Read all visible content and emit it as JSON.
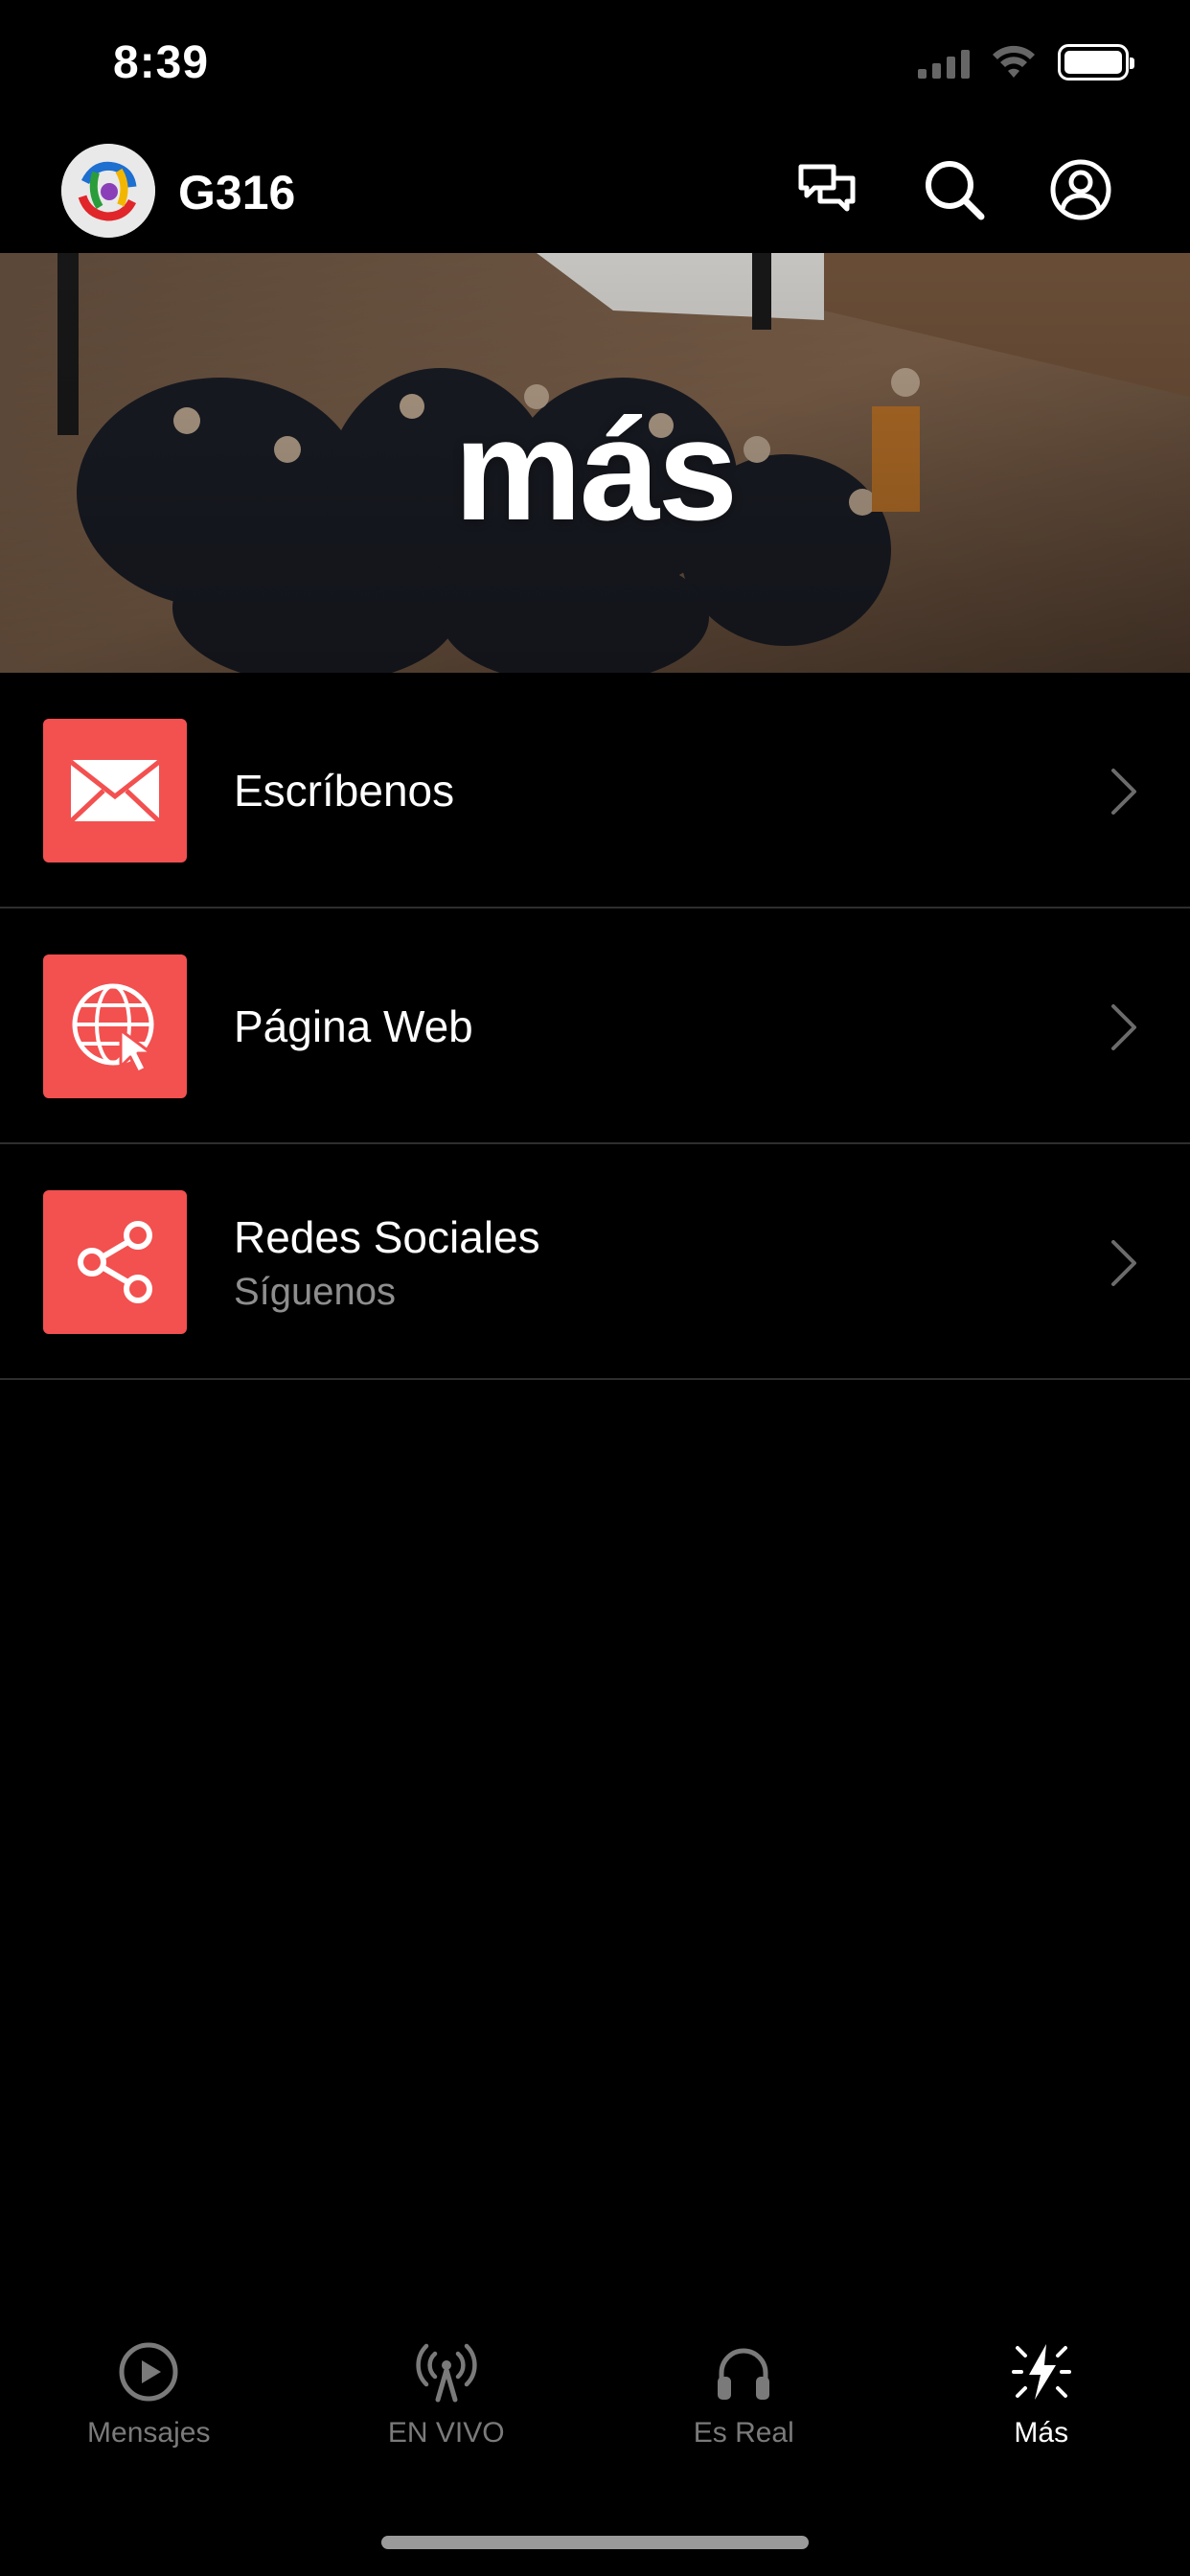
{
  "status_bar": {
    "time": "8:39"
  },
  "header": {
    "title": "G316"
  },
  "hero": {
    "title": "más"
  },
  "menu": [
    {
      "title": "Escríbenos",
      "subtitle": "",
      "icon": "mail-icon"
    },
    {
      "title": "Página Web",
      "subtitle": "",
      "icon": "globe-cursor-icon"
    },
    {
      "title": "Redes Sociales",
      "subtitle": "Síguenos",
      "icon": "share-icon"
    }
  ],
  "tabs": [
    {
      "label": "Mensajes",
      "icon": "play-circle-icon",
      "active": false
    },
    {
      "label": "EN VIVO",
      "icon": "broadcast-icon",
      "active": false
    },
    {
      "label": "Es Real",
      "icon": "headphones-icon",
      "active": false
    },
    {
      "label": "Más",
      "icon": "sparkle-bolt-icon",
      "active": true
    }
  ],
  "colors": {
    "accent": "#f35050",
    "background": "#000000",
    "inactive_tab": "#7a7a7a"
  }
}
